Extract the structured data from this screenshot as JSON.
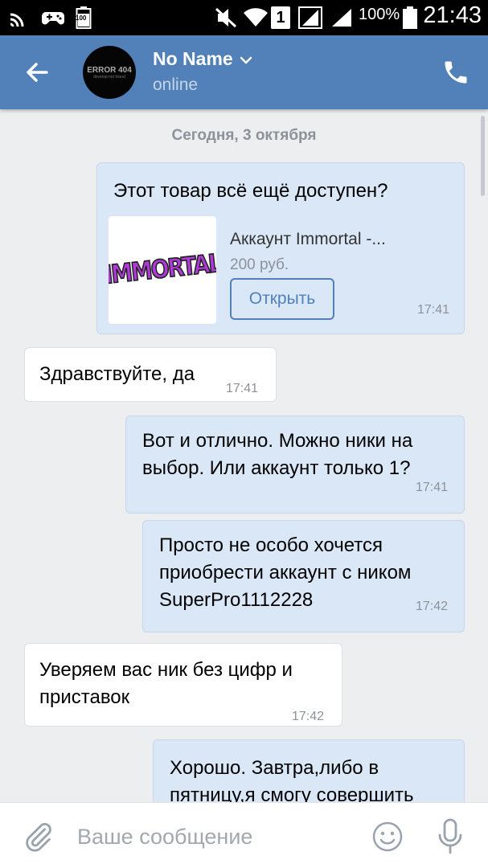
{
  "status_bar": {
    "battery_badge": "100",
    "sim_number": "1",
    "battery_percent": "100%",
    "time": "21:43",
    "icons": [
      "cast-icon",
      "gamepad-icon",
      "battery-saver-icon",
      "mute-icon",
      "wifi-icon",
      "sim-icon",
      "signal-icon",
      "signal-icon",
      "battery-icon"
    ]
  },
  "header": {
    "contact_name": "No Name",
    "contact_status": "online",
    "avatar_text_main": "ERROR 404",
    "avatar_text_sub": "develop not found",
    "icons": [
      "back-arrow-icon",
      "chevron-down-icon",
      "phone-icon"
    ]
  },
  "chat": {
    "date_divider": "Сегодня, 3 октября",
    "messages": [
      {
        "direction": "out",
        "text": "Этот товар всё ещё доступен?",
        "product": {
          "image_text": "IMMORTAL",
          "title": "Аккаунт Immortal -...",
          "price": "200 руб.",
          "button_label": "Открыть"
        },
        "time": "17:41"
      },
      {
        "direction": "in",
        "text": "Здравствуйте, да",
        "time": "17:41"
      },
      {
        "direction": "out",
        "lines": [
          "Вот и отлично. Можно ники на",
          "выбор. Или аккаунт только 1?"
        ],
        "time": "17:41"
      },
      {
        "direction": "out",
        "lines": [
          "Просто не особо хочется",
          "приобрести аккаунт с ником",
          "SuperPro1112228"
        ],
        "time": "17:42"
      },
      {
        "direction": "in",
        "lines": [
          "Уверяем вас ник без цифр и",
          "приставок"
        ],
        "time": "17:42"
      },
      {
        "direction": "out",
        "lines": [
          "Хорошо. Завтра,либо в",
          "пятницу,я смогу совершить"
        ],
        "time": ""
      }
    ]
  },
  "input_bar": {
    "placeholder": "Ваше сообщение",
    "value": "",
    "icons": [
      "paperclip-icon",
      "emoji-icon",
      "microphone-icon"
    ]
  },
  "colors": {
    "header_bg": "#5181b8",
    "outgoing_bubble": "#d9e7f7",
    "incoming_bubble": "#ffffff",
    "chat_bg": "#edeef0",
    "accent": "#5181b8"
  }
}
